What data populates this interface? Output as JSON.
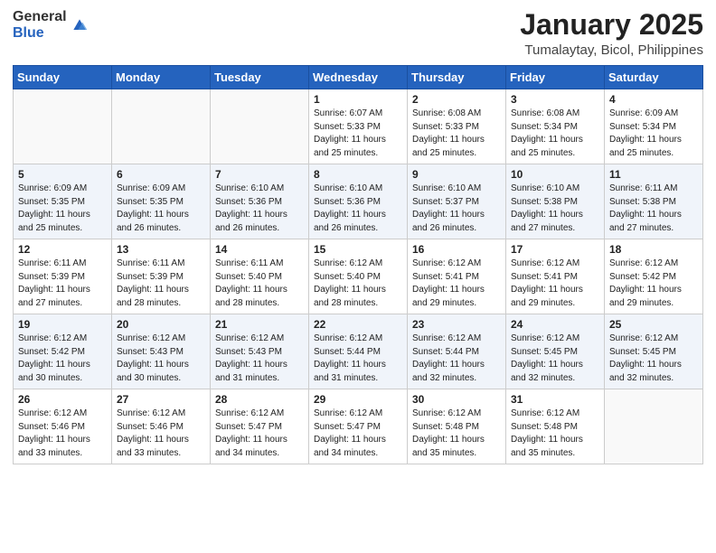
{
  "logo": {
    "general": "General",
    "blue": "Blue"
  },
  "title": "January 2025",
  "subtitle": "Tumalaytay, Bicol, Philippines",
  "days_header": [
    "Sunday",
    "Monday",
    "Tuesday",
    "Wednesday",
    "Thursday",
    "Friday",
    "Saturday"
  ],
  "weeks": [
    [
      {
        "day": "",
        "sunrise": "",
        "sunset": "",
        "daylight": ""
      },
      {
        "day": "",
        "sunrise": "",
        "sunset": "",
        "daylight": ""
      },
      {
        "day": "",
        "sunrise": "",
        "sunset": "",
        "daylight": ""
      },
      {
        "day": "1",
        "sunrise": "Sunrise: 6:07 AM",
        "sunset": "Sunset: 5:33 PM",
        "daylight": "Daylight: 11 hours and 25 minutes."
      },
      {
        "day": "2",
        "sunrise": "Sunrise: 6:08 AM",
        "sunset": "Sunset: 5:33 PM",
        "daylight": "Daylight: 11 hours and 25 minutes."
      },
      {
        "day": "3",
        "sunrise": "Sunrise: 6:08 AM",
        "sunset": "Sunset: 5:34 PM",
        "daylight": "Daylight: 11 hours and 25 minutes."
      },
      {
        "day": "4",
        "sunrise": "Sunrise: 6:09 AM",
        "sunset": "Sunset: 5:34 PM",
        "daylight": "Daylight: 11 hours and 25 minutes."
      }
    ],
    [
      {
        "day": "5",
        "sunrise": "Sunrise: 6:09 AM",
        "sunset": "Sunset: 5:35 PM",
        "daylight": "Daylight: 11 hours and 25 minutes."
      },
      {
        "day": "6",
        "sunrise": "Sunrise: 6:09 AM",
        "sunset": "Sunset: 5:35 PM",
        "daylight": "Daylight: 11 hours and 26 minutes."
      },
      {
        "day": "7",
        "sunrise": "Sunrise: 6:10 AM",
        "sunset": "Sunset: 5:36 PM",
        "daylight": "Daylight: 11 hours and 26 minutes."
      },
      {
        "day": "8",
        "sunrise": "Sunrise: 6:10 AM",
        "sunset": "Sunset: 5:36 PM",
        "daylight": "Daylight: 11 hours and 26 minutes."
      },
      {
        "day": "9",
        "sunrise": "Sunrise: 6:10 AM",
        "sunset": "Sunset: 5:37 PM",
        "daylight": "Daylight: 11 hours and 26 minutes."
      },
      {
        "day": "10",
        "sunrise": "Sunrise: 6:10 AM",
        "sunset": "Sunset: 5:38 PM",
        "daylight": "Daylight: 11 hours and 27 minutes."
      },
      {
        "day": "11",
        "sunrise": "Sunrise: 6:11 AM",
        "sunset": "Sunset: 5:38 PM",
        "daylight": "Daylight: 11 hours and 27 minutes."
      }
    ],
    [
      {
        "day": "12",
        "sunrise": "Sunrise: 6:11 AM",
        "sunset": "Sunset: 5:39 PM",
        "daylight": "Daylight: 11 hours and 27 minutes."
      },
      {
        "day": "13",
        "sunrise": "Sunrise: 6:11 AM",
        "sunset": "Sunset: 5:39 PM",
        "daylight": "Daylight: 11 hours and 28 minutes."
      },
      {
        "day": "14",
        "sunrise": "Sunrise: 6:11 AM",
        "sunset": "Sunset: 5:40 PM",
        "daylight": "Daylight: 11 hours and 28 minutes."
      },
      {
        "day": "15",
        "sunrise": "Sunrise: 6:12 AM",
        "sunset": "Sunset: 5:40 PM",
        "daylight": "Daylight: 11 hours and 28 minutes."
      },
      {
        "day": "16",
        "sunrise": "Sunrise: 6:12 AM",
        "sunset": "Sunset: 5:41 PM",
        "daylight": "Daylight: 11 hours and 29 minutes."
      },
      {
        "day": "17",
        "sunrise": "Sunrise: 6:12 AM",
        "sunset": "Sunset: 5:41 PM",
        "daylight": "Daylight: 11 hours and 29 minutes."
      },
      {
        "day": "18",
        "sunrise": "Sunrise: 6:12 AM",
        "sunset": "Sunset: 5:42 PM",
        "daylight": "Daylight: 11 hours and 29 minutes."
      }
    ],
    [
      {
        "day": "19",
        "sunrise": "Sunrise: 6:12 AM",
        "sunset": "Sunset: 5:42 PM",
        "daylight": "Daylight: 11 hours and 30 minutes."
      },
      {
        "day": "20",
        "sunrise": "Sunrise: 6:12 AM",
        "sunset": "Sunset: 5:43 PM",
        "daylight": "Daylight: 11 hours and 30 minutes."
      },
      {
        "day": "21",
        "sunrise": "Sunrise: 6:12 AM",
        "sunset": "Sunset: 5:43 PM",
        "daylight": "Daylight: 11 hours and 31 minutes."
      },
      {
        "day": "22",
        "sunrise": "Sunrise: 6:12 AM",
        "sunset": "Sunset: 5:44 PM",
        "daylight": "Daylight: 11 hours and 31 minutes."
      },
      {
        "day": "23",
        "sunrise": "Sunrise: 6:12 AM",
        "sunset": "Sunset: 5:44 PM",
        "daylight": "Daylight: 11 hours and 32 minutes."
      },
      {
        "day": "24",
        "sunrise": "Sunrise: 6:12 AM",
        "sunset": "Sunset: 5:45 PM",
        "daylight": "Daylight: 11 hours and 32 minutes."
      },
      {
        "day": "25",
        "sunrise": "Sunrise: 6:12 AM",
        "sunset": "Sunset: 5:45 PM",
        "daylight": "Daylight: 11 hours and 32 minutes."
      }
    ],
    [
      {
        "day": "26",
        "sunrise": "Sunrise: 6:12 AM",
        "sunset": "Sunset: 5:46 PM",
        "daylight": "Daylight: 11 hours and 33 minutes."
      },
      {
        "day": "27",
        "sunrise": "Sunrise: 6:12 AM",
        "sunset": "Sunset: 5:46 PM",
        "daylight": "Daylight: 11 hours and 33 minutes."
      },
      {
        "day": "28",
        "sunrise": "Sunrise: 6:12 AM",
        "sunset": "Sunset: 5:47 PM",
        "daylight": "Daylight: 11 hours and 34 minutes."
      },
      {
        "day": "29",
        "sunrise": "Sunrise: 6:12 AM",
        "sunset": "Sunset: 5:47 PM",
        "daylight": "Daylight: 11 hours and 34 minutes."
      },
      {
        "day": "30",
        "sunrise": "Sunrise: 6:12 AM",
        "sunset": "Sunset: 5:48 PM",
        "daylight": "Daylight: 11 hours and 35 minutes."
      },
      {
        "day": "31",
        "sunrise": "Sunrise: 6:12 AM",
        "sunset": "Sunset: 5:48 PM",
        "daylight": "Daylight: 11 hours and 35 minutes."
      },
      {
        "day": "",
        "sunrise": "",
        "sunset": "",
        "daylight": ""
      }
    ]
  ]
}
